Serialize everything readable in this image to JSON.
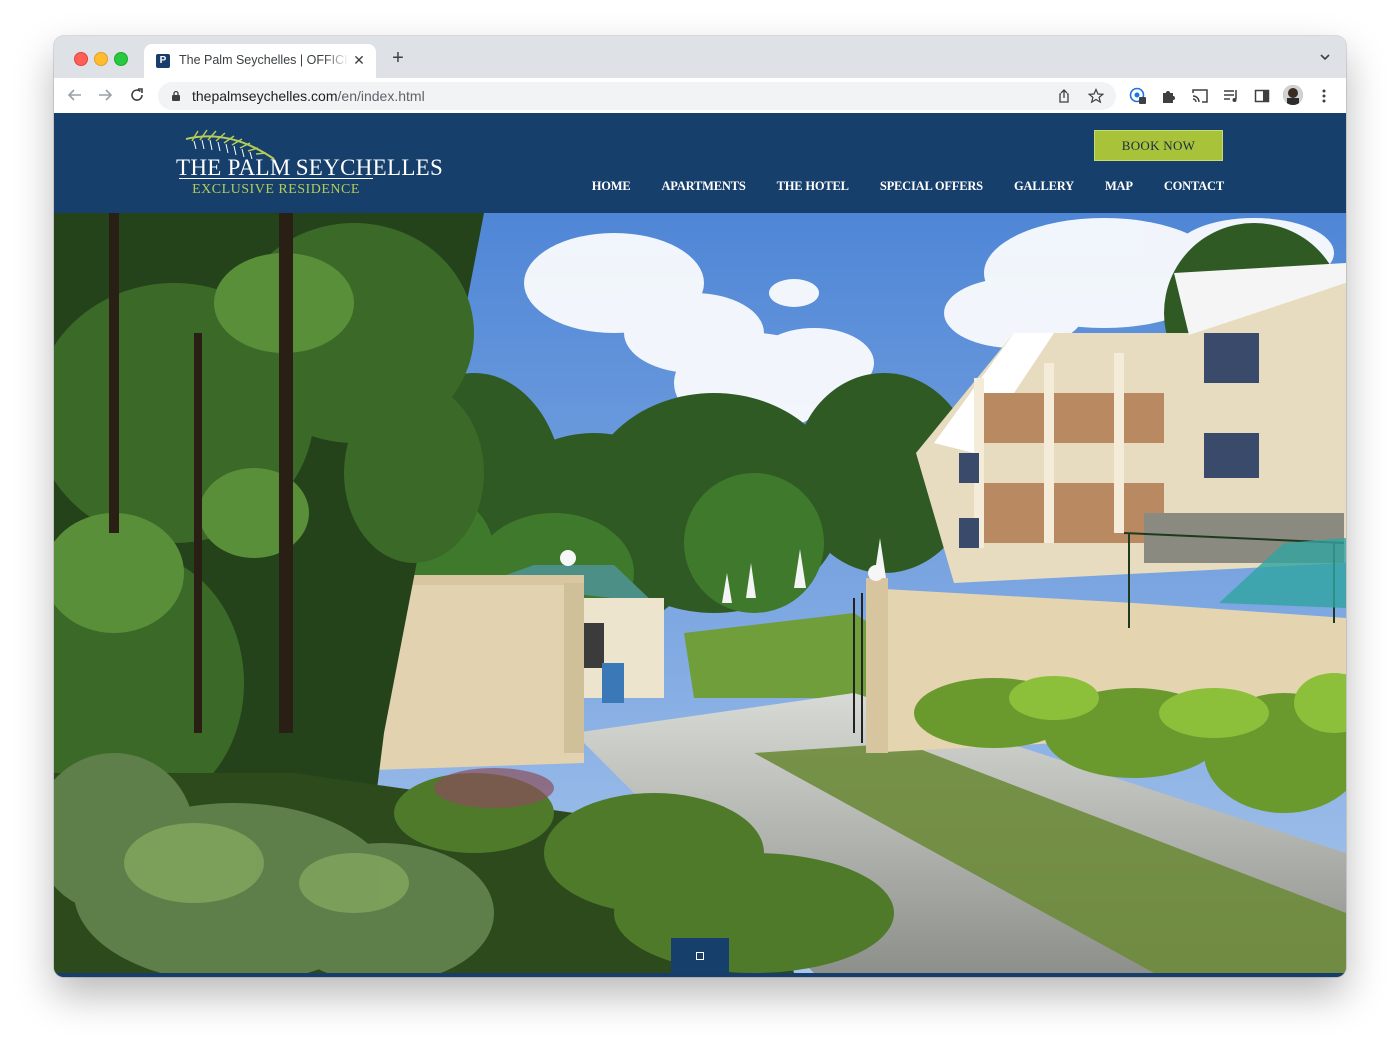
{
  "browser": {
    "tab": {
      "title": "The Palm Seychelles | OFFICIAL",
      "favicon_letter": "P"
    },
    "address_bar": {
      "domain": "thepalmseychelles.com",
      "path": "/en/index.html"
    },
    "icons": [
      "back-icon",
      "forward-icon",
      "reload-icon",
      "lock-icon",
      "share-icon",
      "star-icon",
      "extension-icon",
      "puzzle-icon",
      "cast-icon",
      "media-icon",
      "sidepanel-icon",
      "menu-icon"
    ]
  },
  "site": {
    "logo": {
      "title_prefix": "THE PALM",
      "title_suffix": "SEYCHELLES",
      "subtitle": "EXCLUSIVE RESIDENCE"
    },
    "book_button": "BOOK NOW",
    "nav": [
      "HOME",
      "APARTMENTS",
      "THE HOTEL",
      "SPECIAL OFFERS",
      "GALLERY",
      "MAP",
      "CONTACT"
    ],
    "colors": {
      "header": "#173f6b",
      "accent": "#a8c23a"
    }
  }
}
